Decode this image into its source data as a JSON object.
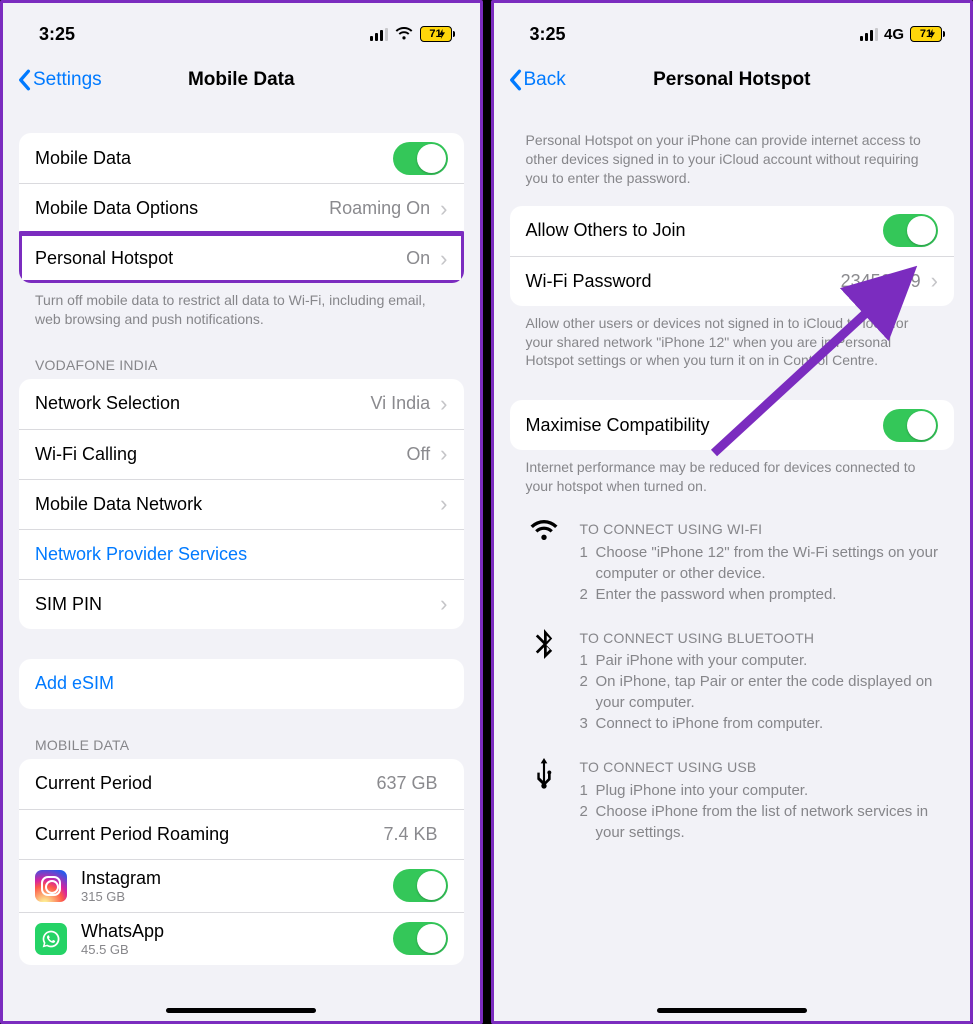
{
  "left": {
    "status": {
      "time": "3:25",
      "battery": "71"
    },
    "nav": {
      "back": "Settings",
      "title": "Mobile Data"
    },
    "group1": {
      "mobile_data": "Mobile Data",
      "mobile_data_options": "Mobile Data Options",
      "mobile_data_options_detail": "Roaming On",
      "personal_hotspot": "Personal Hotspot",
      "personal_hotspot_detail": "On"
    },
    "group1_footer": "Turn off mobile data to restrict all data to Wi-Fi, including email, web browsing and push notifications.",
    "carrier_header": "VODAFONE INDIA",
    "carrier": {
      "network_selection": "Network Selection",
      "network_selection_detail": "Vi India",
      "wifi_calling": "Wi-Fi Calling",
      "wifi_calling_detail": "Off",
      "mobile_data_network": "Mobile Data Network",
      "provider_services": "Network Provider Services",
      "sim_pin": "SIM PIN"
    },
    "add_esim": "Add eSIM",
    "usage_header": "MOBILE DATA",
    "usage": {
      "current_period": "Current Period",
      "current_period_val": "637 GB",
      "roaming": "Current Period Roaming",
      "roaming_val": "7.4 KB",
      "instagram": "Instagram",
      "instagram_sub": "315 GB",
      "whatsapp": "WhatsApp",
      "whatsapp_sub": "45.5 GB"
    }
  },
  "right": {
    "status": {
      "time": "3:25",
      "net": "4G",
      "battery": "71"
    },
    "nav": {
      "back": "Back",
      "title": "Personal Hotspot"
    },
    "intro": "Personal Hotspot on your iPhone can provide internet access to other devices signed in to your iCloud account without requiring you to enter the password.",
    "group1": {
      "allow": "Allow Others to Join",
      "wifi_pw": "Wi-Fi Password",
      "wifi_pw_val": "23456789"
    },
    "group1_footer": "Allow other users or devices not signed in to iCloud to look for your shared network \"iPhone 12\" when you are in Personal Hotspot settings or when you turn it on in Control Centre.",
    "group2": {
      "max_compat": "Maximise Compatibility"
    },
    "group2_footer": "Internet performance may be reduced for devices connected to your hotspot when turned on.",
    "instr_wifi": {
      "h": "TO CONNECT USING WI-FI",
      "l1": "Choose \"iPhone 12\" from the Wi-Fi settings on your computer or other device.",
      "l2": "Enter the password when prompted."
    },
    "instr_bt": {
      "h": "TO CONNECT USING BLUETOOTH",
      "l1": "Pair iPhone with your computer.",
      "l2": "On iPhone, tap Pair or enter the code displayed on your computer.",
      "l3": "Connect to iPhone from computer."
    },
    "instr_usb": {
      "h": "TO CONNECT USING USB",
      "l1": "Plug iPhone into your computer.",
      "l2": "Choose iPhone from the list of network services in your settings."
    }
  }
}
